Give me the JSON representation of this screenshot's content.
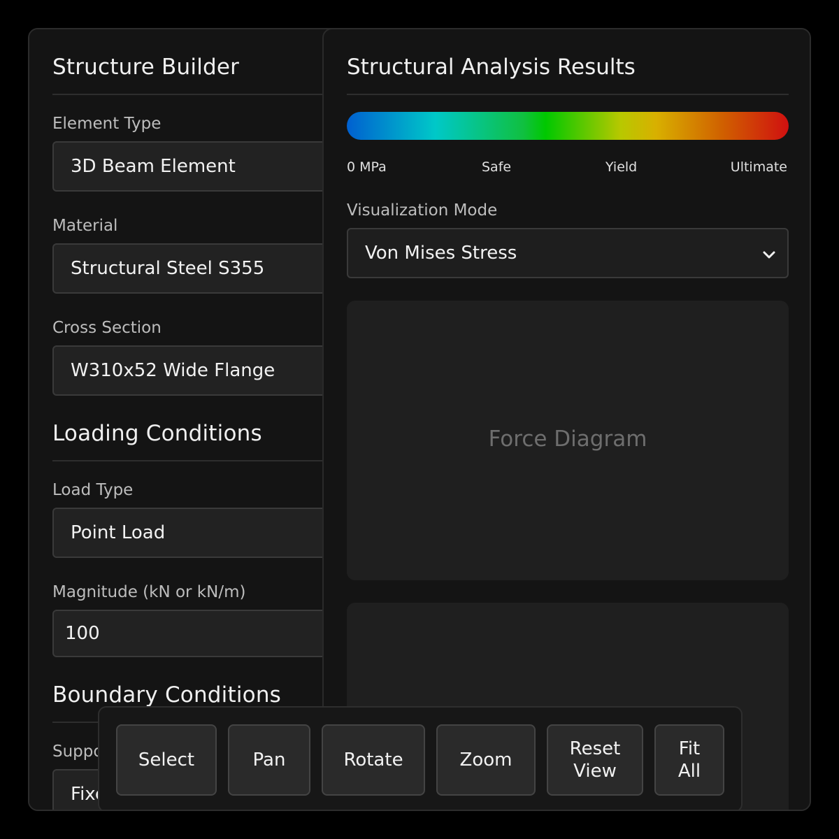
{
  "left_panel": {
    "title": "Structure Builder",
    "element_type": {
      "label": "Element Type",
      "value": "3D Beam Element"
    },
    "material": {
      "label": "Material",
      "value": "Structural Steel S355"
    },
    "cross_section": {
      "label": "Cross Section",
      "value": "W310x52 Wide Flange"
    },
    "loading_title": "Loading Conditions",
    "load_type": {
      "label": "Load Type",
      "value": "Point Load"
    },
    "magnitude": {
      "label": "Magnitude (kN or kN/m)",
      "value": "100"
    },
    "boundary_title": "Boundary Conditions",
    "support": {
      "label": "Suppo",
      "value": "Fixe"
    }
  },
  "right_panel": {
    "title": "Structural Analysis Results",
    "scale": {
      "labels": [
        "0 MPa",
        "Safe",
        "Yield",
        "Ultimate"
      ],
      "colors": [
        "#0060d0",
        "#00c8c8",
        "#00c800",
        "#d8b000",
        "#d01010"
      ]
    },
    "viz_mode": {
      "label": "Visualization Mode",
      "value": "Von Mises Stress"
    },
    "diagram_placeholder": "Force Diagram"
  },
  "toolbar": {
    "buttons": [
      "Select",
      "Pan",
      "Rotate",
      "Zoom",
      "Reset View",
      "Fit All"
    ]
  }
}
